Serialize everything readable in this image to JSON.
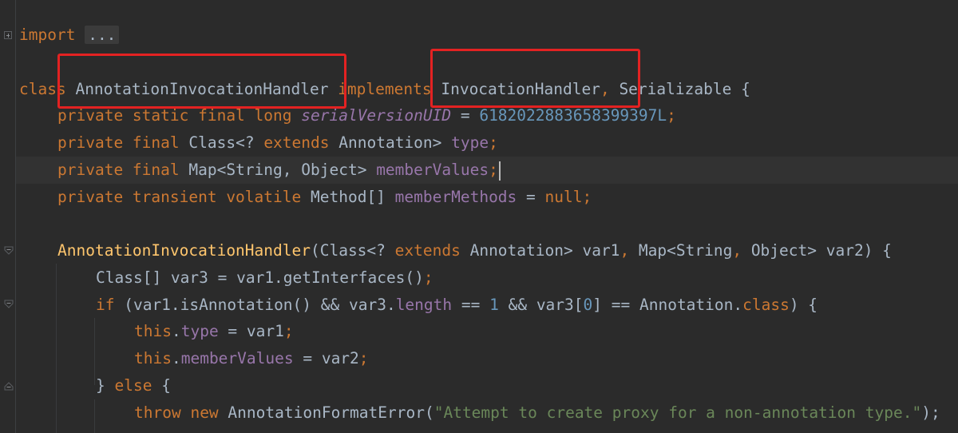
{
  "editor": {
    "lines": {
      "import_kw": "import",
      "import_folded": "...",
      "class_kw": "class",
      "class_name": "AnnotationInvocationHandler",
      "implements_kw": "implements",
      "iface1": "InvocationHandler",
      "comma1": ",",
      "iface2": "Serializable",
      "brace_open": "{",
      "l1_mods": "private static final long",
      "l1_field": "serialVersionUID",
      "l1_eq": " = ",
      "l1_val": "6182022883658399397L",
      "l1_semi": ";",
      "l2_mods": "private final",
      "l2_type": "Class<?",
      "l2_extends": "extends",
      "l2_type2": "Annotation>",
      "l2_field": "type",
      "l2_semi": ";",
      "l3_mods": "private final",
      "l3_type": "Map<String, Object>",
      "l3_field": "memberValues",
      "l3_semi": ";",
      "l4_mods": "private transient volatile",
      "l4_type": "Method[]",
      "l4_field": "memberMethods",
      "l4_eq": " = ",
      "l4_null": "null",
      "l4_semi": ";",
      "ctor_name": "AnnotationInvocationHandler",
      "ctor_p1": "(Class<? ",
      "ctor_extends": "extends",
      "ctor_p2": " Annotation> var1",
      "ctor_comma": ",",
      "ctor_p3": " Map<String",
      "ctor_comma2": ",",
      "ctor_p4": " Object> var2) {",
      "b1": "Class[] var3 = var1.getInterfaces()",
      "b1_semi": ";",
      "if_kw": "if",
      "if_p1": " (var1.isAnnotation() && var3.",
      "if_length": "length",
      "if_p2": " == ",
      "if_one": "1",
      "if_p3": " && var3[",
      "if_zero": "0",
      "if_p4": "] == Annotation.",
      "if_class": "class",
      "if_p5": ") {",
      "this_kw": "this",
      "t1_dot": ".",
      "t1_field": "type",
      "t1_rest": " = var1",
      "t1_semi": ";",
      "t2_dot": ".",
      "t2_field": "memberValues",
      "t2_rest": " = var2",
      "t2_semi": ";",
      "else_brace": "} ",
      "else_kw": "else",
      "else_rest": " {",
      "throw_kw": "throw",
      "new_kw": "new",
      "throw_cls": " AnnotationFormatError(",
      "throw_str": "\"Attempt to create proxy for a non-annotation type.\"",
      "throw_end": ");"
    }
  }
}
